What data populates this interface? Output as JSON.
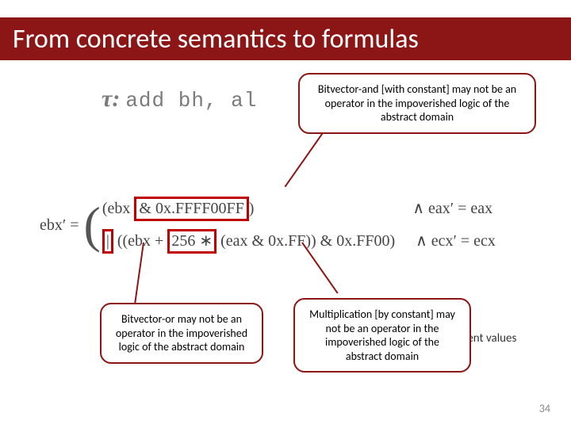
{
  "title": "From concrete semantics to formulas",
  "tau_prefix": "τ:",
  "instruction": "add bh, al",
  "formula": {
    "lhs": "ebx′ =",
    "line1_a": "(ebx ",
    "line1_and": "& 0x.FFFF00FF",
    "line1_b": ")",
    "line1_tail": "∧ eax′ = eax",
    "line2_or": "|",
    "line2_a": " ((ebx + ",
    "line2_mul": "256 ∗",
    "line2_b": " (eax & 0x.FF)) & 0x.FF00)",
    "line2_tail": "∧ ecx′ = ecx"
  },
  "callouts": {
    "and": "Bitvector-and [with constant] may not be an operator in the impoverished logic of the abstract domain",
    "or": "Bitvector-or may not be an operator in the impoverished logic of the abstract domain",
    "mul": "Multiplication [by constant] may not be an operator in the impoverished logic of the abstract domain"
  },
  "present_values": "esent values",
  "page_number": "34"
}
